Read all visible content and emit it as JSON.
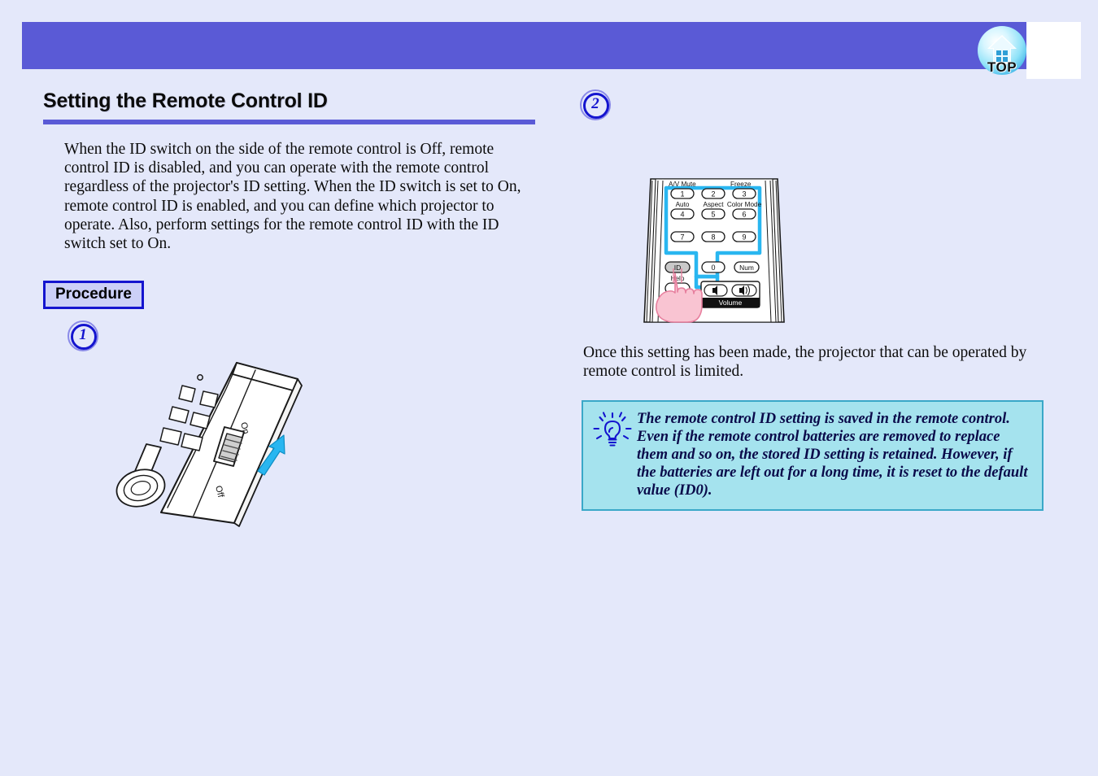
{
  "header": {
    "top_button_label": "TOP",
    "top_button_icon": "home-top-icon",
    "band_color": "#5a5ad6"
  },
  "section": {
    "title": "Setting the Remote Control ID",
    "rule_color": "#5a5ad6",
    "intro": "When the ID switch on the side of the remote control is Off, remote control ID is disabled, and you can operate with the remote control regardless of the projector's ID setting. When the ID switch is set to On, remote control ID is enabled, and you can define which projector to operate. Also, perform settings for the remote control ID with the ID switch set to On."
  },
  "procedure": {
    "label": "Procedure",
    "steps": [
      {
        "number": "1"
      },
      {
        "number": "2"
      }
    ]
  },
  "figure_remote_side": {
    "caption_alt": "remote-control-side-view",
    "switch_on_label": "On",
    "switch_off_label": "Off",
    "arrow_color": "#29b6f0"
  },
  "figure_remote_keypad": {
    "caption_alt": "remote-control-keypad",
    "highlight_color": "#29b6f0",
    "top_labels": [
      "A/V Mute",
      "",
      "Freeze"
    ],
    "mid_labels": [
      "Auto",
      "Aspect",
      "Color Mode"
    ],
    "keys_row1": [
      "1",
      "2",
      "3"
    ],
    "keys_row2": [
      "4",
      "5",
      "6"
    ],
    "keys_row3": [
      "7",
      "8",
      "9"
    ],
    "keys_row4": [
      "ID",
      "0",
      "Num"
    ],
    "help_label": "Help",
    "volume_label": "Volume",
    "id_key_label": "ID",
    "pressed_key": "ID"
  },
  "result": {
    "text": "Once this setting has been made, the projector that can be operated by remote control is limited."
  },
  "tip": {
    "icon": "lightbulb-icon",
    "text": "The remote control ID setting is saved in the remote control. Even if the remote control batteries are removed to replace them and so on, the stored ID setting is retained. However, if the batteries are left out for a long time, it is reset to the default value (ID0).",
    "border_color": "#3aa8c8",
    "background_color": "#a5e3ee"
  },
  "page": {
    "background_color": "#e4e8fa"
  }
}
